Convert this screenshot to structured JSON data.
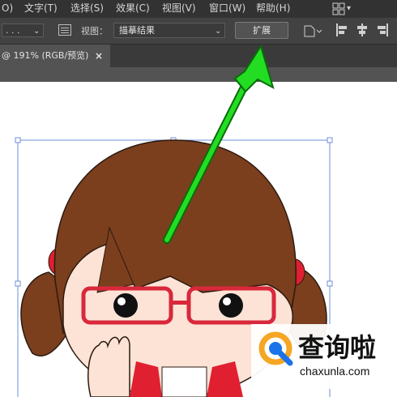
{
  "menu": {
    "items": [
      {
        "id": "o",
        "label": "O)"
      },
      {
        "id": "type",
        "label": "文字(T)"
      },
      {
        "id": "select",
        "label": "选择(S)"
      },
      {
        "id": "effect",
        "label": "效果(C)"
      },
      {
        "id": "view",
        "label": "视图(V)"
      },
      {
        "id": "window",
        "label": "窗口(W)"
      },
      {
        "id": "help",
        "label": "帮助(H)"
      }
    ],
    "workspace_icon": "grid-workspace-icon"
  },
  "options_bar": {
    "dots_value": ". . .",
    "view_label": "视图：",
    "view_value": "描摹结果",
    "expand_label": "扩展"
  },
  "tab": {
    "title": "@ 191% (RGB/预览)",
    "close": "×"
  },
  "watermark": {
    "brand": "查询啦",
    "url": "chaxunla.com"
  },
  "colors": {
    "menubar": "#323232",
    "panel": "#424242",
    "canvas": "#ffffff",
    "arrow": "#22dd22",
    "hair": "#7b3f1e",
    "skin": "#fce3d6",
    "glasses": "#d9283b",
    "shirt": "#e02030",
    "watermark_orange": "#f5a623",
    "watermark_blue": "#1a73e8"
  }
}
